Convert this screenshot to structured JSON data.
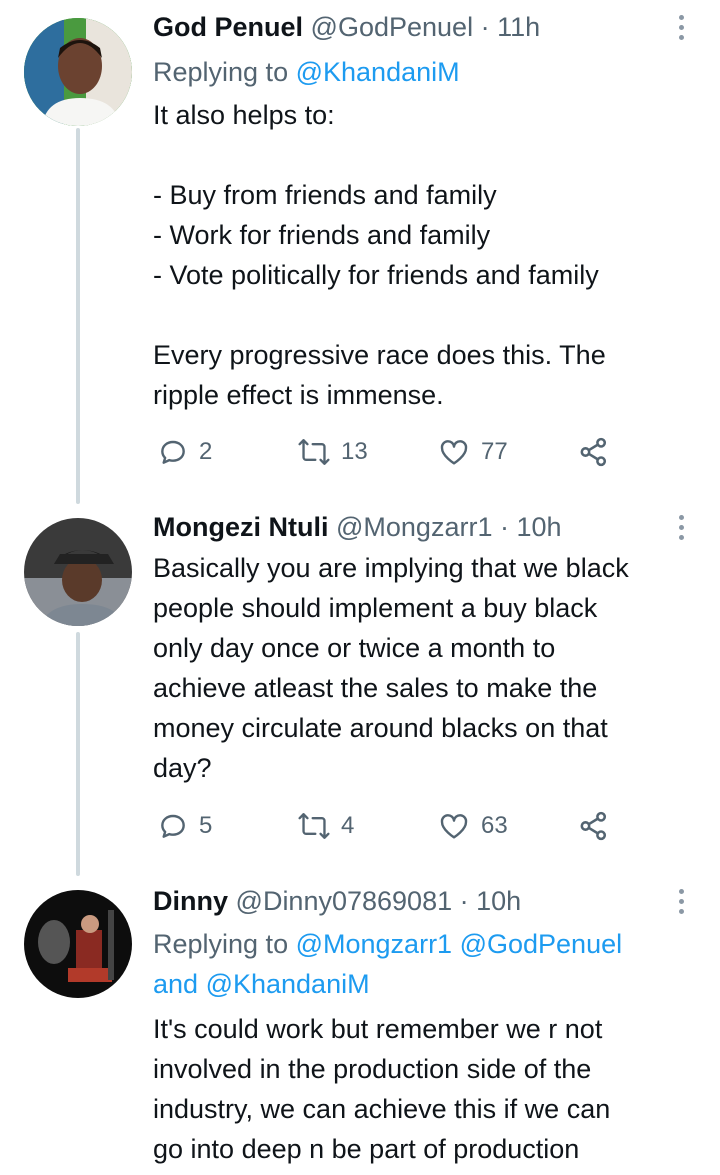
{
  "tweets": [
    {
      "name": "God Penuel",
      "handle": "@GodPenuel",
      "sep": "·",
      "time": "11h",
      "replying_prefix": "Replying to",
      "replying_to": "@KhandaniM",
      "body": "It also helps to:\n\n- Buy from friends and family\n- Work for friends and family\n- Vote politically for friends and family\n\nEvery progressive race does this. The\nripple effect is immense.",
      "replies": "2",
      "retweets": "13",
      "likes": "77"
    },
    {
      "name": "Mongezi Ntuli",
      "handle": "@Mongzarr1",
      "sep": "·",
      "time": "10h",
      "body": "Basically you are implying that we black\npeople should implement a buy black\nonly day once or twice a month to\nachieve atleast the sales to make the\nmoney circulate around blacks on that\nday?",
      "replies": "5",
      "retweets": "4",
      "likes": "63"
    },
    {
      "name": "Dinny",
      "handle": "@Dinny07869081",
      "sep": "·",
      "time": "10h",
      "replying_prefix": "Replying to",
      "replying_to_1": "@Mongzarr1",
      "replying_to_2": "@GodPenuel",
      "replying_and": "and",
      "replying_to_3": "@KhandaniM",
      "body": "It's could work but remember we r not\ninvolved in the production side of the\nindustry, we can achieve this if we can\ngo into deep n be part of production"
    }
  ],
  "icons": {
    "reply": "reply-icon",
    "retweet": "retweet-icon",
    "like": "heart-icon",
    "share": "share-icon",
    "more": "more-options-icon"
  },
  "colors": {
    "link": "#1d9bf0",
    "secondary_text": "#536471",
    "thread_line": "#cfd9de"
  }
}
